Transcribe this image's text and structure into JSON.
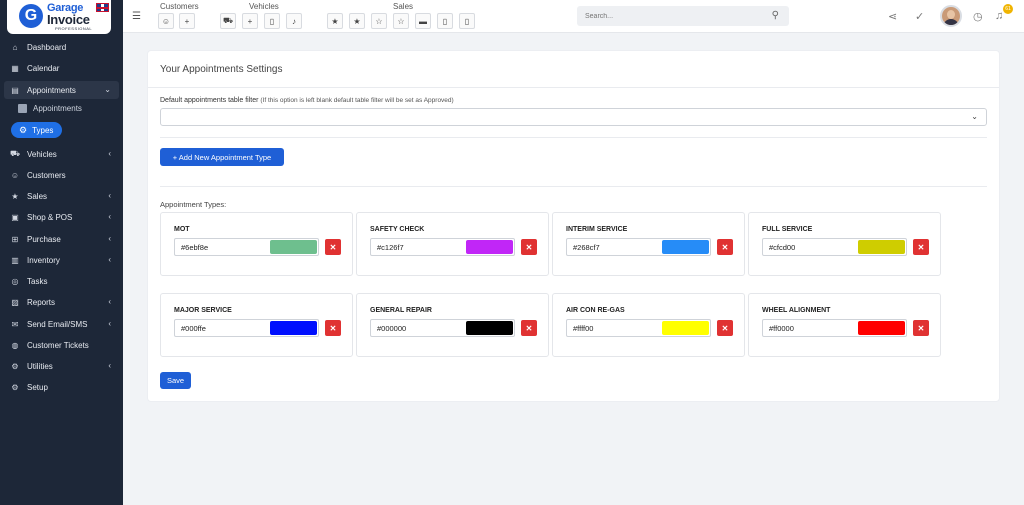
{
  "logo": {
    "mark": "G",
    "line1": "Garage",
    "line2": "Invoice",
    "line3": "PROFESSIONAL"
  },
  "sidebar": {
    "items": [
      {
        "label": "Dashboard",
        "icon": "home-icon",
        "glyph": "⌂"
      },
      {
        "label": "Calendar",
        "icon": "calendar-icon",
        "glyph": "▦"
      },
      {
        "label": "Appointments",
        "icon": "clipboard-icon",
        "glyph": "▤"
      },
      {
        "label": "Vehicles",
        "icon": "car-icon",
        "glyph": "⛟"
      },
      {
        "label": "Customers",
        "icon": "user-icon",
        "glyph": "☺"
      },
      {
        "label": "Sales",
        "icon": "star-icon",
        "glyph": "★"
      },
      {
        "label": "Shop & POS",
        "icon": "shop-icon",
        "glyph": "▣"
      },
      {
        "label": "Purchase",
        "icon": "cart-icon",
        "glyph": "⊞"
      },
      {
        "label": "Inventory",
        "icon": "box-icon",
        "glyph": "▥"
      },
      {
        "label": "Tasks",
        "icon": "check-circle-icon",
        "glyph": "◎"
      },
      {
        "label": "Reports",
        "icon": "chart-icon",
        "glyph": "▨"
      },
      {
        "label": "Send Email/SMS",
        "icon": "envelope-icon",
        "glyph": "✉"
      },
      {
        "label": "Customer Tickets",
        "icon": "ticket-icon",
        "glyph": "◍"
      },
      {
        "label": "Utilities",
        "icon": "gears-icon",
        "glyph": "⚙"
      },
      {
        "label": "Setup",
        "icon": "gear-icon",
        "glyph": "⚙"
      }
    ],
    "sub_appointments": "Appointments",
    "sub_types": "Types"
  },
  "header": {
    "groups": {
      "customers": "Customers",
      "vehicles": "Vehicles",
      "sales": "Sales"
    },
    "search_placeholder": "Search...",
    "notification_count": "61"
  },
  "main": {
    "title": "Your Appointments Settings",
    "filter_label": "Default appointments table filter",
    "filter_note": "(If this option is left blank default table filter will be set as Approved)",
    "filter_value": "",
    "add_button": "+ Add New Appointment Type",
    "types_label": "Appointment Types:",
    "types": [
      {
        "name": "MOT",
        "hex": "#6ebf8e",
        "color": "#6ebf8e"
      },
      {
        "name": "SAFETY CHECK",
        "hex": "#c126f7",
        "color": "#c126f7"
      },
      {
        "name": "INTERIM SERVICE",
        "hex": "#268cf7",
        "color": "#268cf7"
      },
      {
        "name": "FULL SERVICE",
        "hex": "#cfcd00",
        "color": "#cfcd00"
      },
      {
        "name": "MAJOR SERVICE",
        "hex": "#000ffe",
        "color": "#000ffe"
      },
      {
        "name": "GENERAL REPAIR",
        "hex": "#000000",
        "color": "#000000"
      },
      {
        "name": "AIR CON RE-GAS",
        "hex": "#ffff00",
        "color": "#ffff00"
      },
      {
        "name": "WHEEL ALIGNMENT",
        "hex": "#ff0000",
        "color": "#ff0000"
      }
    ],
    "delete_glyph": "✕",
    "save_button": "Save"
  },
  "colors": {
    "sidebar_bg": "#1d2738",
    "primary": "#1f5fd6",
    "danger": "#e03232"
  }
}
